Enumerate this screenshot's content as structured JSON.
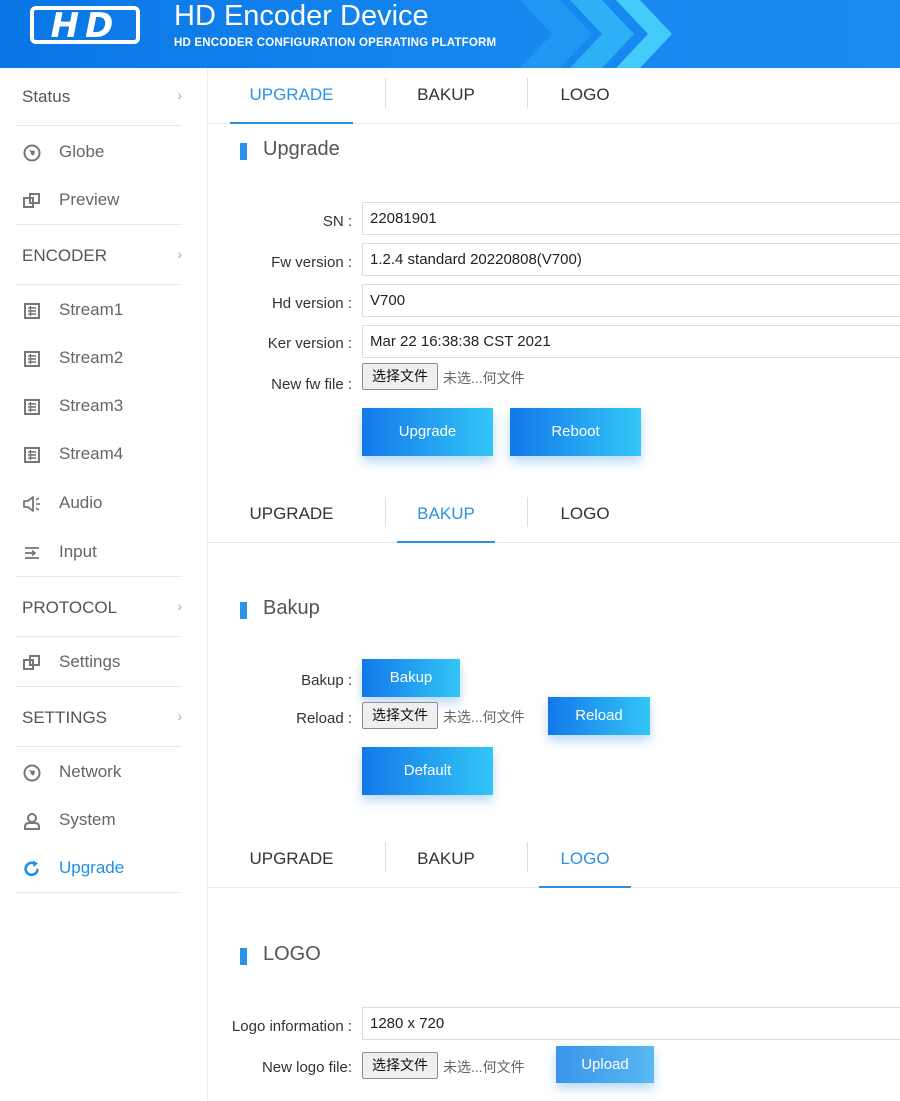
{
  "header": {
    "logo_text": "HD",
    "title": "HD Encoder Device",
    "subtitle": "HD ENCODER CONFIGURATION OPERATING PLATFORM"
  },
  "sidebar": {
    "sections": [
      {
        "label": "Status",
        "items": [
          {
            "label": "Globe",
            "icon": "globe-icon"
          },
          {
            "label": "Preview",
            "icon": "window-icon"
          }
        ]
      },
      {
        "label": "ENCODER",
        "items": [
          {
            "label": "Stream1",
            "icon": "grid-icon"
          },
          {
            "label": "Stream2",
            "icon": "grid-icon"
          },
          {
            "label": "Stream3",
            "icon": "grid-icon"
          },
          {
            "label": "Stream4",
            "icon": "grid-icon"
          },
          {
            "label": "Audio",
            "icon": "speaker-icon"
          },
          {
            "label": "Input",
            "icon": "input-icon"
          }
        ]
      },
      {
        "label": "PROTOCOL",
        "items": [
          {
            "label": "Settings",
            "icon": "window-icon"
          }
        ]
      },
      {
        "label": "SETTINGS",
        "items": [
          {
            "label": "Network",
            "icon": "globe-icon"
          },
          {
            "label": "System",
            "icon": "user-icon"
          },
          {
            "label": "Upgrade",
            "icon": "refresh-icon"
          }
        ]
      }
    ],
    "arrow": "›",
    "active_item": "Upgrade"
  },
  "tabs": {
    "upgrade": "UPGRADE",
    "bakup": "BAKUP",
    "logo": "LOGO"
  },
  "upgrade": {
    "title": "Upgrade",
    "sn_label": "SN :",
    "sn_value": "22081901",
    "fw_label": "Fw version :",
    "fw_value": "1.2.4 standard 20220808(V700)",
    "hd_label": "Hd version :",
    "hd_value": "V700",
    "ker_label": "Ker version :",
    "ker_value": "Mar 22 16:38:38 CST 2021",
    "newfw_label": "New fw file :",
    "upgrade_button": "Upgrade",
    "reboot_button": "Reboot"
  },
  "bakup": {
    "title": "Bakup",
    "bakup_label": "Bakup :",
    "bakup_button": "Bakup",
    "reload_label": "Reload :",
    "reload_button": "Reload",
    "default_button": "Default"
  },
  "logo": {
    "title": "LOGO",
    "info_label": "Logo information :",
    "info_value": "1280 x 720",
    "newlogo_label": "New logo file:",
    "upload_button": "Upload"
  },
  "file_input": {
    "button": "选择文件",
    "status": "未选...何文件"
  },
  "colors": {
    "header_blue": "#0a76e6",
    "accent": "#2b93e6",
    "button_start": "#1378ea",
    "button_end": "#33c6f6"
  }
}
